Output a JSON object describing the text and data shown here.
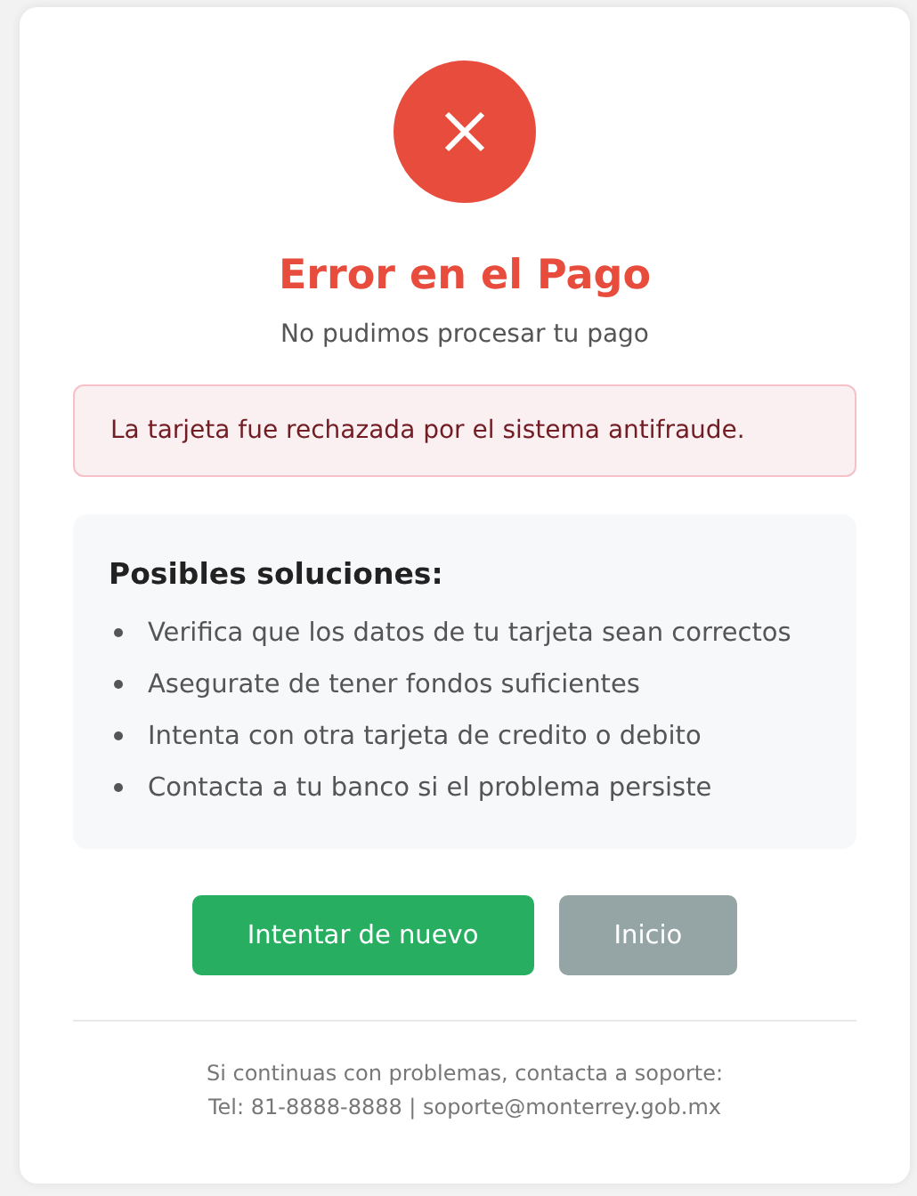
{
  "status": {
    "kind": "error",
    "title": "Error en el Pago",
    "subtitle": "No pudimos procesar tu pago"
  },
  "alert": {
    "message": "La tarjeta fue rechazada por el sistema antifraude."
  },
  "solutions": {
    "heading": "Posibles soluciones:",
    "items": [
      "Verifica que los datos de tu tarjeta sean correctos",
      "Asegurate de tener fondos suficientes",
      "Intenta con otra tarjeta de credito o debito",
      "Contacta a tu banco si el problema persiste"
    ]
  },
  "buttons": [
    {
      "label": "Intentar de nuevo",
      "kind": "primary"
    },
    {
      "label": "Inicio",
      "kind": "secondary"
    }
  ],
  "footer": [
    "Si continuas con problemas, contacta a soporte:",
    "Tel: 81-8888-8888 | soporte@monterrey.gob.mx"
  ]
}
